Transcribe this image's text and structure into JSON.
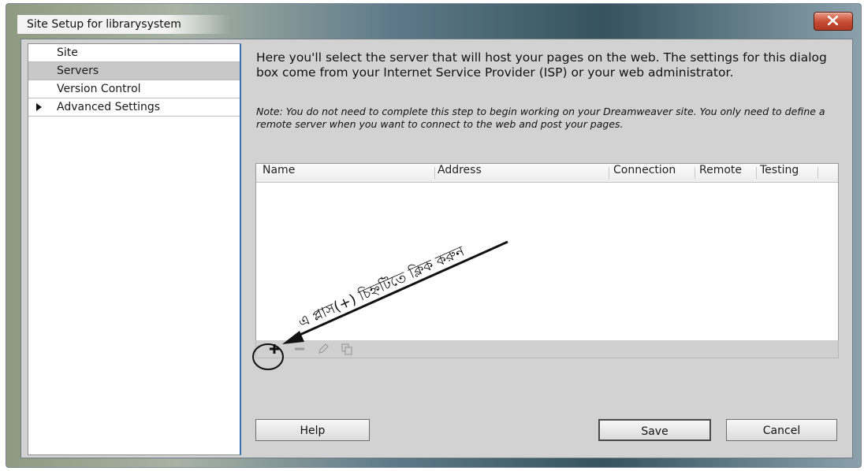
{
  "window": {
    "title": "Site Setup for librarysystem",
    "close_icon": "close-x-icon",
    "accent": "#3a6fb0",
    "close_color": "#c54a32"
  },
  "sidebar": {
    "items": [
      {
        "label": "Site",
        "selected": false,
        "has_arrow": false
      },
      {
        "label": "Servers",
        "selected": true,
        "has_arrow": false
      },
      {
        "label": "Version Control",
        "selected": false,
        "has_arrow": false
      },
      {
        "label": "Advanced Settings",
        "selected": false,
        "has_arrow": true
      }
    ]
  },
  "main": {
    "intro": "Here you'll select the server that will host your pages on the web. The settings for this dialog box come from your Internet Service Provider (ISP) or your web administrator.",
    "note": "Note: You do not need to complete this step to begin working on your Dreamweaver site. You only need to define a remote server when you want to connect to the web and post your pages.",
    "table": {
      "columns": [
        "Name",
        "Address",
        "Connection",
        "Remote",
        "Testing"
      ],
      "rows": []
    },
    "toolbar": {
      "icons": [
        "plus-icon",
        "minus-icon",
        "pencil-icon",
        "duplicate-icon"
      ]
    }
  },
  "annotation": {
    "text": "এ প্লাস(+) চিহ্নটিতে ক্লিক করুন",
    "icons": [
      "arrow-icon",
      "circle-highlight"
    ]
  },
  "buttons": {
    "help": "Help",
    "save": "Save",
    "cancel": "Cancel"
  }
}
